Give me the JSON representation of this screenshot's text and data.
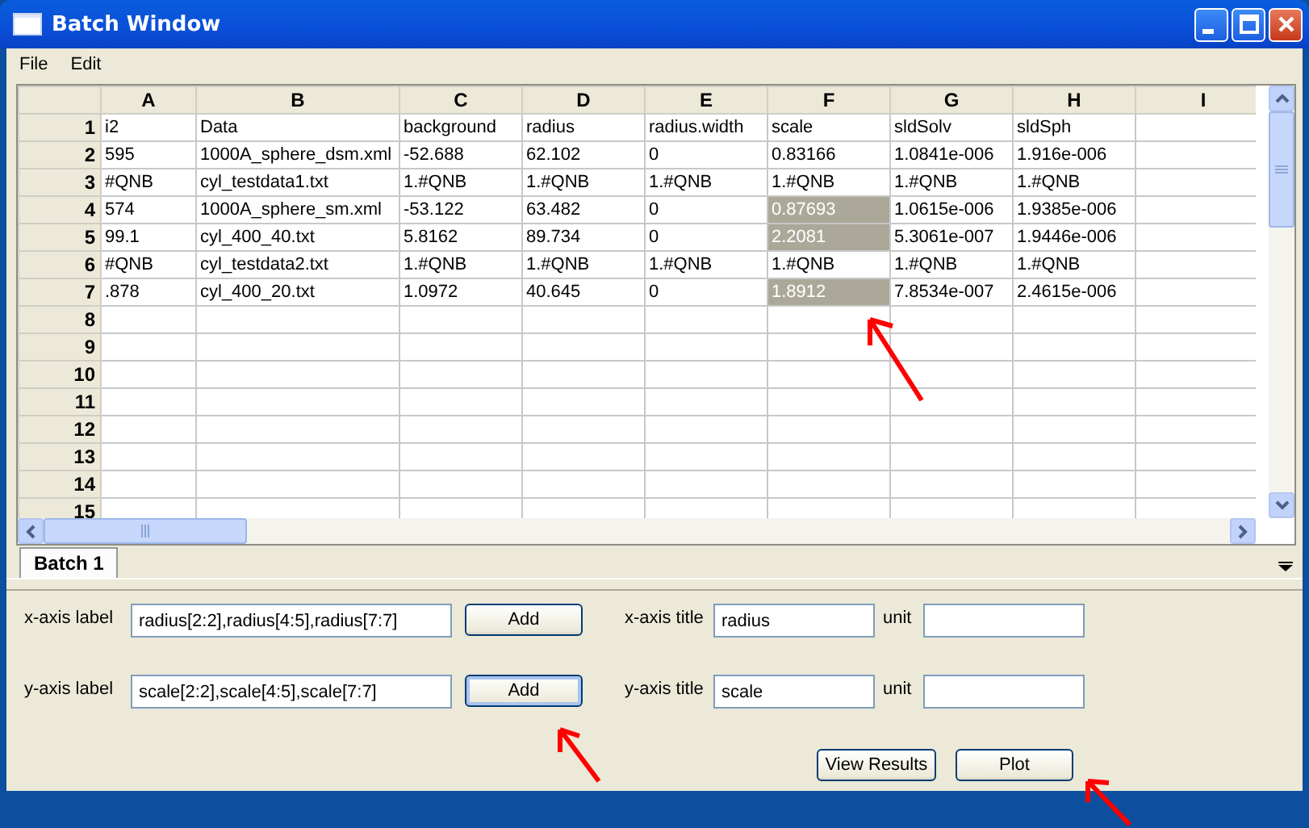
{
  "window": {
    "title": "Batch Window"
  },
  "menu": [
    "File",
    "Edit"
  ],
  "grid": {
    "columns": [
      "A",
      "B",
      "C",
      "D",
      "E",
      "F",
      "G",
      "H",
      "I"
    ],
    "rows": [
      {
        "number": "1",
        "cells": [
          {
            "text": "i2",
            "selected": false
          },
          {
            "text": "Data",
            "selected": false
          },
          {
            "text": "background",
            "selected": false
          },
          {
            "text": "radius",
            "selected": false
          },
          {
            "text": "radius.width",
            "selected": false
          },
          {
            "text": "scale",
            "selected": false
          },
          {
            "text": "sldSolv",
            "selected": false
          },
          {
            "text": "sldSph",
            "selected": false
          }
        ]
      },
      {
        "number": "2",
        "cells": [
          {
            "text": "595",
            "selected": false
          },
          {
            "text": "1000A_sphere_dsm.xml",
            "selected": false
          },
          {
            "text": "-52.688",
            "selected": false
          },
          {
            "text": "62.102",
            "selected": false
          },
          {
            "text": "0",
            "selected": false
          },
          {
            "text": "0.83166",
            "selected": false
          },
          {
            "text": "1.0841e-006",
            "selected": false
          },
          {
            "text": "1.916e-006",
            "selected": false
          }
        ]
      },
      {
        "number": "3",
        "cells": [
          {
            "text": "#QNB",
            "selected": false
          },
          {
            "text": "cyl_testdata1.txt",
            "selected": false
          },
          {
            "text": "1.#QNB",
            "selected": false
          },
          {
            "text": "1.#QNB",
            "selected": false
          },
          {
            "text": "1.#QNB",
            "selected": false
          },
          {
            "text": "1.#QNB",
            "selected": false
          },
          {
            "text": "1.#QNB",
            "selected": false
          },
          {
            "text": "1.#QNB",
            "selected": false
          }
        ]
      },
      {
        "number": "4",
        "cells": [
          {
            "text": "574",
            "selected": false
          },
          {
            "text": "1000A_sphere_sm.xml",
            "selected": false
          },
          {
            "text": "-53.122",
            "selected": false
          },
          {
            "text": "63.482",
            "selected": false
          },
          {
            "text": "0",
            "selected": false
          },
          {
            "text": "0.87693",
            "selected": true
          },
          {
            "text": "1.0615e-006",
            "selected": false
          },
          {
            "text": "1.9385e-006",
            "selected": false
          }
        ]
      },
      {
        "number": "5",
        "cells": [
          {
            "text": "99.1",
            "selected": false
          },
          {
            "text": "cyl_400_40.txt",
            "selected": false
          },
          {
            "text": "5.8162",
            "selected": false
          },
          {
            "text": "89.734",
            "selected": false
          },
          {
            "text": "0",
            "selected": false
          },
          {
            "text": "2.2081",
            "selected": true
          },
          {
            "text": "5.3061e-007",
            "selected": false
          },
          {
            "text": "1.9446e-006",
            "selected": false
          }
        ]
      },
      {
        "number": "6",
        "cells": [
          {
            "text": "#QNB",
            "selected": false
          },
          {
            "text": "cyl_testdata2.txt",
            "selected": false
          },
          {
            "text": "1.#QNB",
            "selected": false
          },
          {
            "text": "1.#QNB",
            "selected": false
          },
          {
            "text": "1.#QNB",
            "selected": false
          },
          {
            "text": "1.#QNB",
            "selected": false
          },
          {
            "text": "1.#QNB",
            "selected": false
          },
          {
            "text": "1.#QNB",
            "selected": false
          }
        ]
      },
      {
        "number": "7",
        "cells": [
          {
            "text": ".878",
            "selected": false
          },
          {
            "text": "cyl_400_20.txt",
            "selected": false
          },
          {
            "text": "1.0972",
            "selected": false
          },
          {
            "text": "40.645",
            "selected": false
          },
          {
            "text": "0",
            "selected": false
          },
          {
            "text": "1.8912",
            "selected": true
          },
          {
            "text": "7.8534e-007",
            "selected": false
          },
          {
            "text": "2.4615e-006",
            "selected": false
          }
        ]
      },
      {
        "number": "8"
      },
      {
        "number": "9"
      },
      {
        "number": "10"
      },
      {
        "number": "11"
      },
      {
        "number": "12"
      },
      {
        "number": "13"
      },
      {
        "number": "14"
      },
      {
        "number": "15"
      }
    ]
  },
  "sheet_tabs": [
    {
      "label": "Batch 1",
      "selected": true
    }
  ],
  "axes": [
    {
      "label": "x-axis label",
      "value": "radius[2:2],radius[4:5],radius[7:7]",
      "button": "Add",
      "button_focused": false,
      "title_label": "x-axis title",
      "title_value": "radius",
      "unit_label": "unit"
    },
    {
      "label": "y-axis label",
      "value": "scale[2:2],scale[4:5],scale[7:7]",
      "button": "Add",
      "button_focused": true,
      "title_label": "y-axis title",
      "title_value": "scale",
      "unit_label": "unit"
    }
  ],
  "buttons": [
    "View Results",
    "Plot"
  ]
}
